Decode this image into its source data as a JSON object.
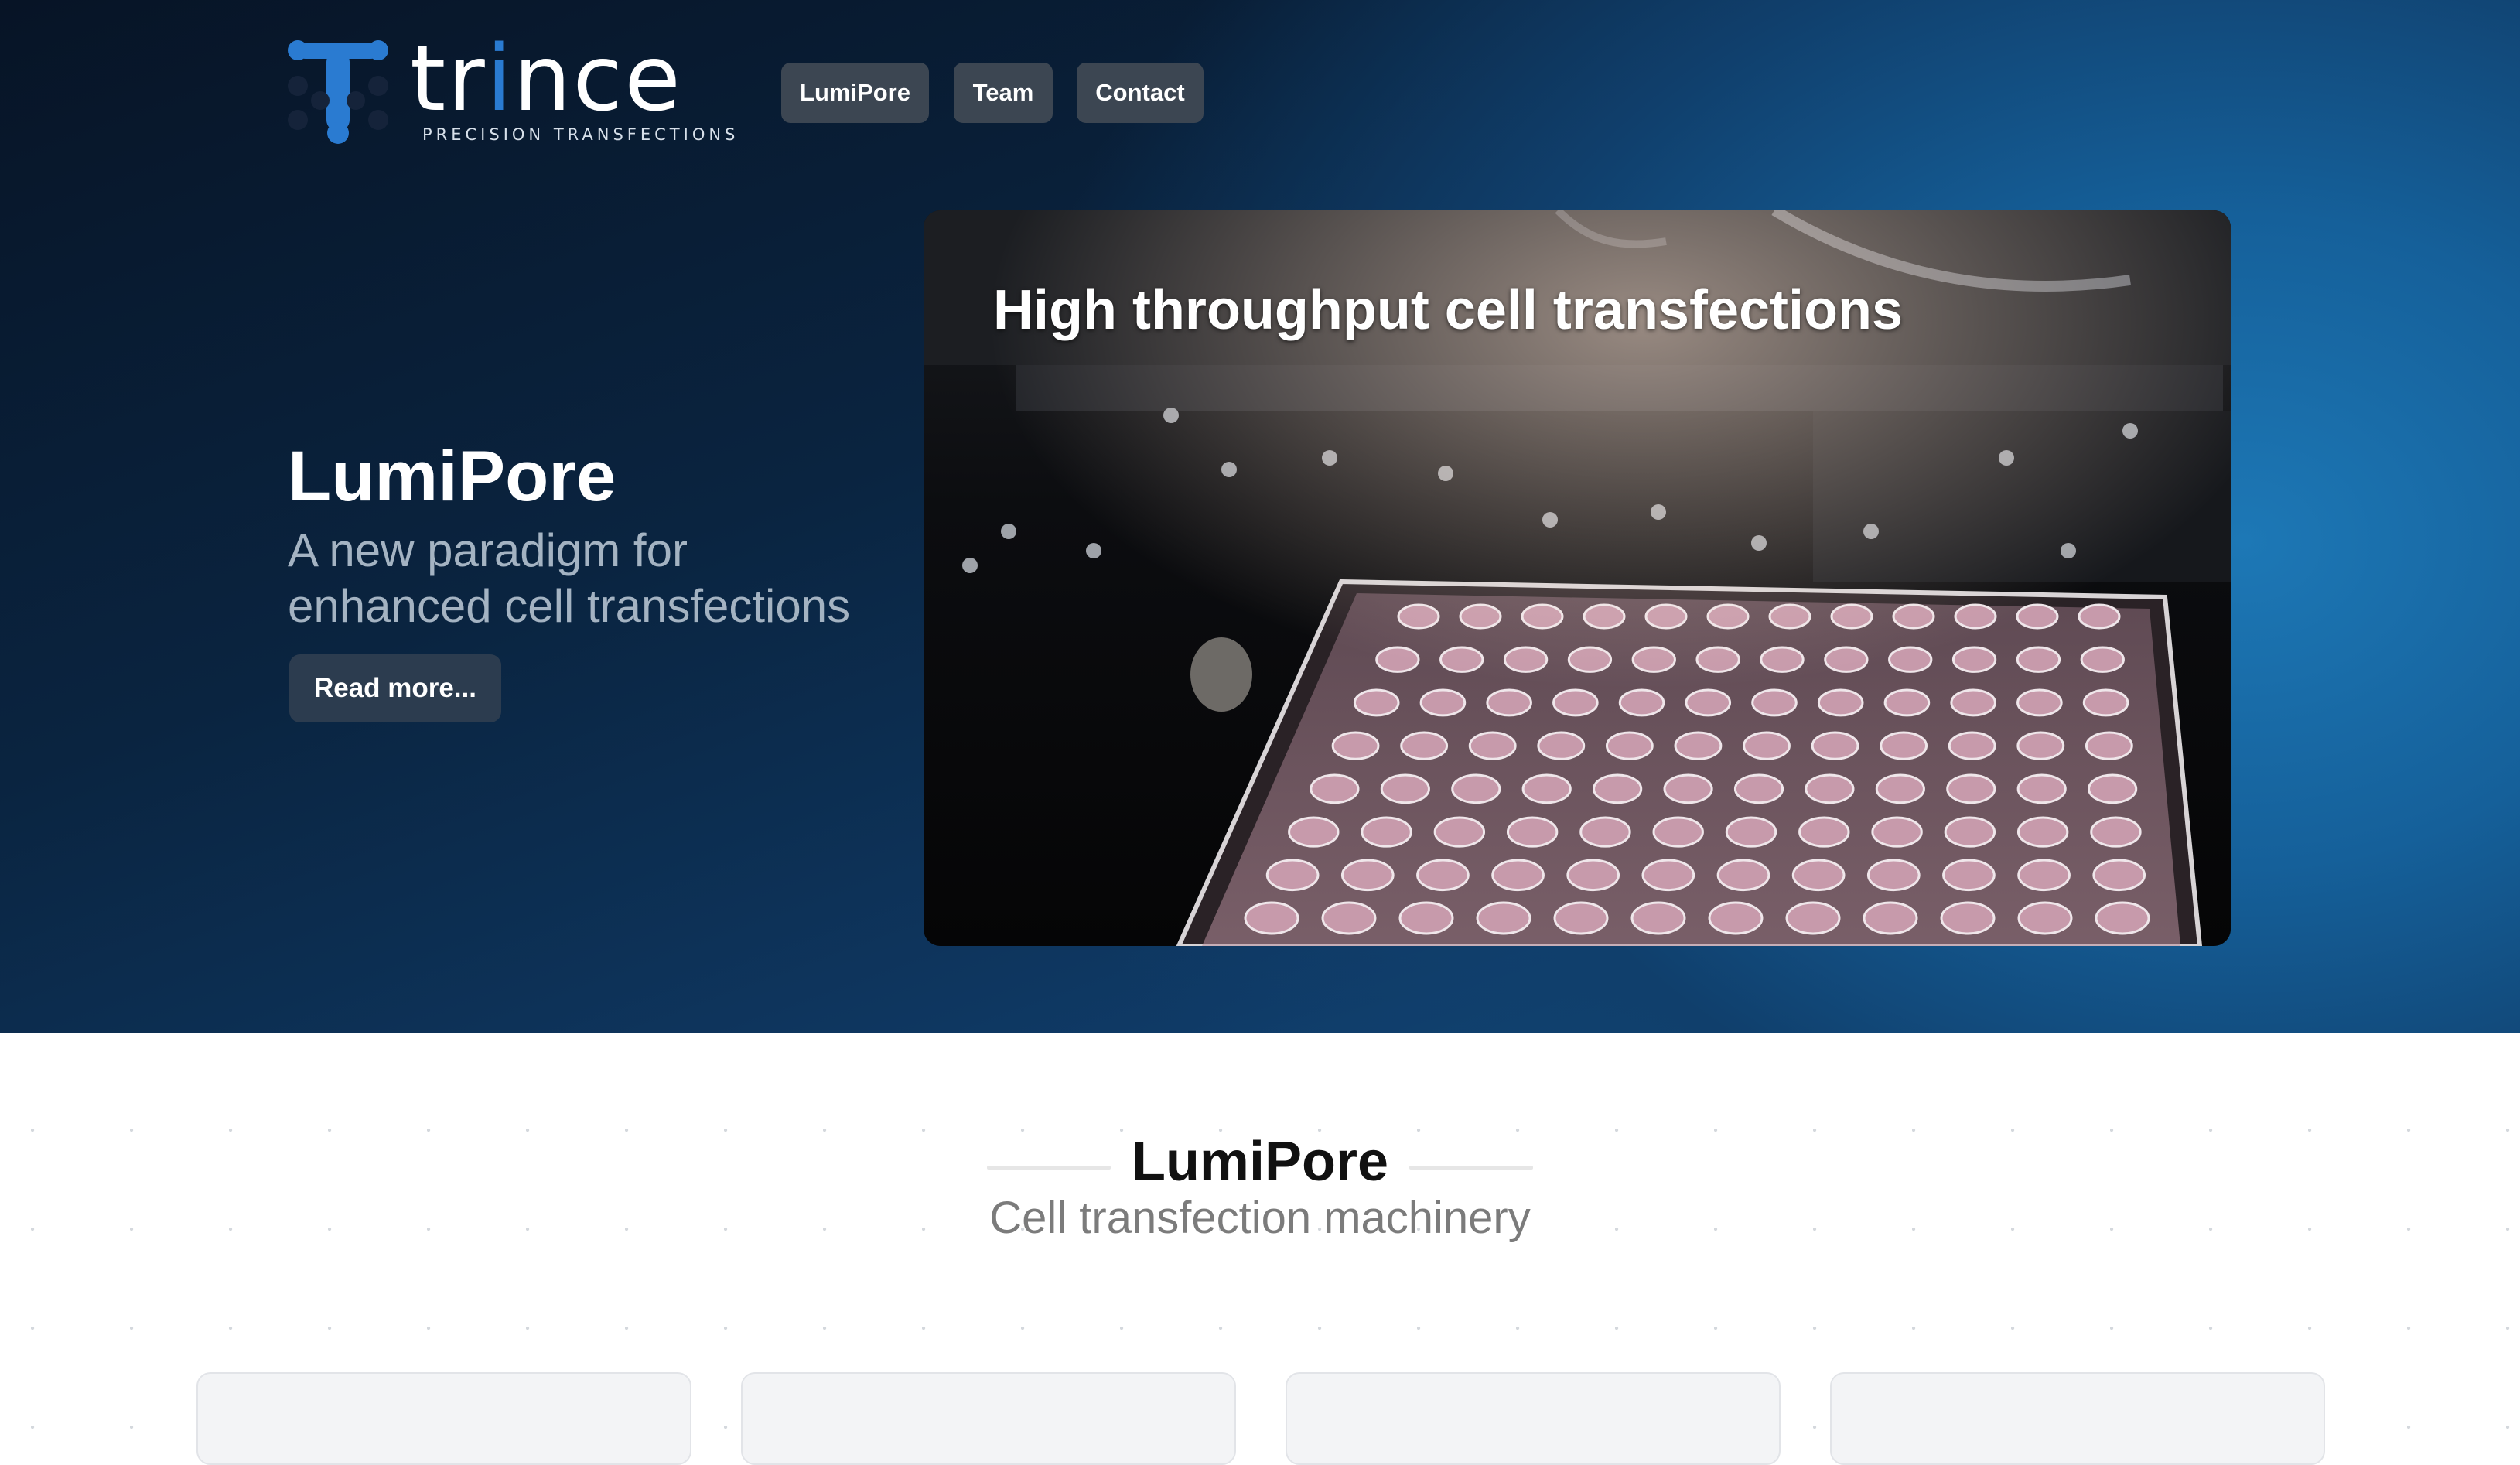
{
  "brand": {
    "name_part1": "tr",
    "name_accent": "i",
    "name_part2": "nce",
    "tagline": "PRECISION TRANSFECTIONS",
    "accent_color": "#2a7bd1"
  },
  "nav": [
    {
      "label": "LumiPore"
    },
    {
      "label": "Team"
    },
    {
      "label": "Contact"
    }
  ],
  "hero": {
    "title": "LumiPore",
    "subtitle_line1": "A new paradigm for",
    "subtitle_line2": "enhanced cell transfections",
    "cta_label": "Read more...",
    "video_caption": "High throughput cell transfections"
  },
  "section": {
    "title": "LumiPore",
    "subtitle": "Cell transfection machinery"
  },
  "colors": {
    "hero_dark": "#071426",
    "hero_blue": "#1d78b6",
    "nav_button": "#3c4652",
    "cta_button": "#2c3c4f"
  }
}
